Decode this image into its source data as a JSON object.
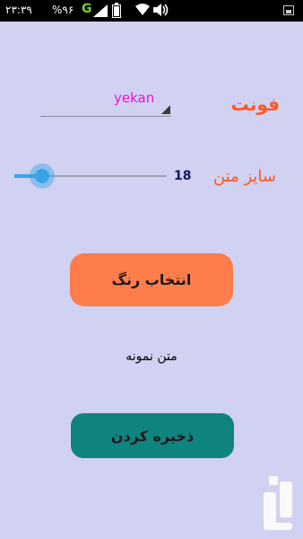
{
  "status_bar": {
    "time": "۲۳:۳۹",
    "battery_percent": "%۹۶",
    "network": "G",
    "icons": [
      "signal-icon",
      "battery-icon",
      "wifi-icon",
      "volume-icon",
      "image-icon"
    ]
  },
  "font": {
    "label": "فونت",
    "selected": "yekan"
  },
  "text_size": {
    "label": "سایز متن",
    "value": "18",
    "slider_fraction": 0.18
  },
  "buttons": {
    "choose_color": "انتخاب رنگ",
    "save": "ذخیره کردن"
  },
  "sample_text": "متن نمونه",
  "colors": {
    "background": "#d1d1f1",
    "label_orange": "#ff5722",
    "spinner_text": "#e216d8",
    "slider_blue": "#36a4e6",
    "color_button": "#ff7c4c",
    "save_button": "#0f847e",
    "size_value": "#0b1a66"
  }
}
